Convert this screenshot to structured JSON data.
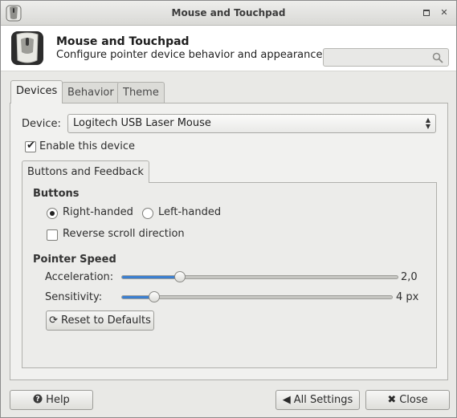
{
  "window": {
    "title": "Mouse and Touchpad"
  },
  "header": {
    "title": "Mouse and Touchpad",
    "subtitle": "Configure pointer device behavior and appearance",
    "search": {
      "value": "",
      "placeholder": ""
    }
  },
  "tabs": [
    {
      "label": "Devices",
      "active": true
    },
    {
      "label": "Behavior",
      "active": false
    },
    {
      "label": "Theme",
      "active": false
    }
  ],
  "devices": {
    "device_label": "Device:",
    "device_value": "Logitech USB Laser Mouse",
    "enable_label": "Enable this device",
    "enable_checked": true,
    "subtab_label": "Buttons and Feedback",
    "buttons": {
      "title": "Buttons",
      "right_handed_label": "Right-handed",
      "left_handed_label": "Left-handed",
      "selected": "right",
      "reverse_scroll_label": "Reverse scroll direction",
      "reverse_scroll_checked": false
    },
    "pointer_speed": {
      "title": "Pointer Speed",
      "acceleration_label": "Acceleration:",
      "acceleration_value": "2,0",
      "acceleration_fraction": 0.21,
      "sensitivity_label": "Sensitivity:",
      "sensitivity_value": "4 px",
      "sensitivity_fraction": 0.12
    },
    "reset_label": "Reset to Defaults"
  },
  "footer": {
    "help_label": "Help",
    "all_settings_label": "All Settings",
    "close_label": "Close"
  },
  "colors": {
    "accent": "#3b7fd0"
  },
  "icons": [
    "mouse-icon",
    "search-icon",
    "maximize-icon",
    "close-icon",
    "reset-icon",
    "help-icon",
    "back-arrow-icon"
  ]
}
